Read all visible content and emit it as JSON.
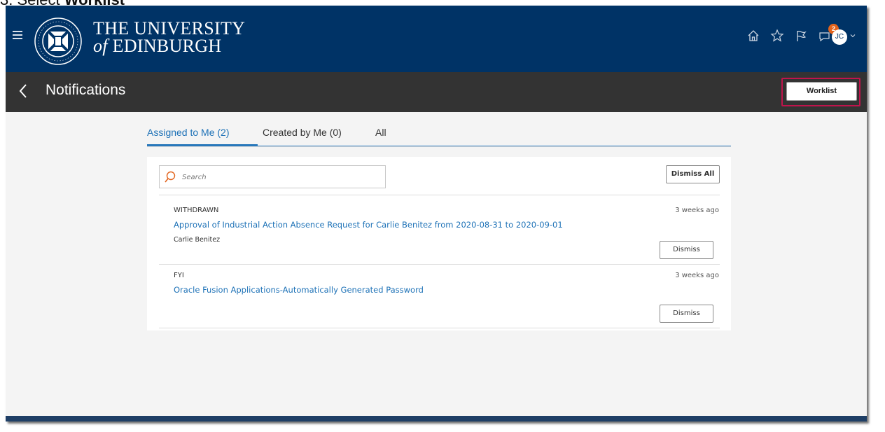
{
  "caption": {
    "prefix": "3. Select ",
    "bold": "Worklist"
  },
  "header": {
    "brand_line1": "THE UNIVERSITY",
    "brand_of": "of",
    "brand_line2": "EDINBURGH",
    "notification_count": "2",
    "avatar_initials": "JC",
    "icons": [
      "menu-icon",
      "university-crest",
      "home-icon",
      "star-icon",
      "flag-icon",
      "notifications-icon",
      "user-avatar",
      "chevron-down-icon"
    ],
    "colors": {
      "header_bg": "#003366",
      "titlebar_bg": "#333333",
      "badge": "#e2631c",
      "link": "#1e72b7",
      "highlight": "#c0144c"
    }
  },
  "titlebar": {
    "title": "Notifications",
    "worklist_label": "Worklist"
  },
  "tabs": [
    {
      "label": "Assigned to Me (2)",
      "active": true
    },
    {
      "label": "Created by Me (0)",
      "active": false
    },
    {
      "label": "All",
      "active": false
    }
  ],
  "panel": {
    "search_placeholder": "Search",
    "dismiss_all_label": "Dismiss All",
    "items": [
      {
        "tag": "WITHDRAWN",
        "time": "3 weeks ago",
        "link": "Approval of Industrial Action Absence Request for Carlie Benitez from 2020-08-31 to 2020-09-01",
        "from": "Carlie Benitez",
        "dismiss_label": "Dismiss"
      },
      {
        "tag": "FYI",
        "time": "3 weeks ago",
        "link": "Oracle Fusion Applications-Automatically Generated Password",
        "from": "",
        "dismiss_label": "Dismiss"
      }
    ]
  }
}
